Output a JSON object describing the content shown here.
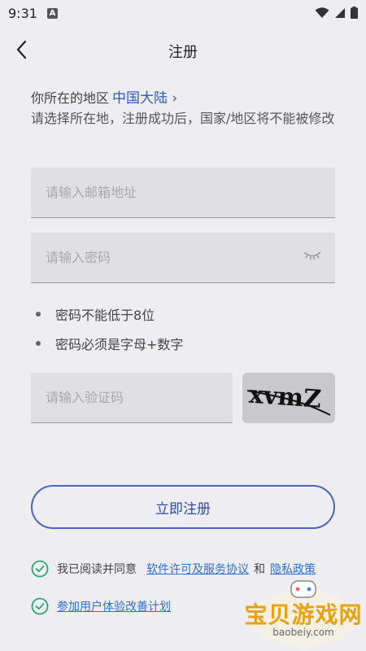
{
  "status": {
    "time": "9:31",
    "notif": "A"
  },
  "header": {
    "title": "注册"
  },
  "region": {
    "label": "你所在的地区",
    "value": "中国大陆 ›",
    "hint": "请选择所在地，注册成功后，国家/地区将不能被修改"
  },
  "form": {
    "email_placeholder": "请输入邮箱地址",
    "password_placeholder": "请输入密码",
    "captcha_placeholder": "请输入验证码",
    "captcha_text": "xvmZ"
  },
  "rules": [
    "密码不能低于8位",
    "密码必须是字母+数字"
  ],
  "submit_label": "立即注册",
  "agreement": {
    "prefix": "我已阅读并同意",
    "license_link": "软件许可及服务协议",
    "and": "和",
    "privacy_link": "隐私政策"
  },
  "improve_link": "参加用户体验改善计划",
  "watermark": {
    "title": "宝贝游戏网",
    "url": "baobeiy.com"
  },
  "colors": {
    "accent": "#2d5bb8",
    "check": "#2aa86a",
    "background": "#ededf2"
  },
  "icons": [
    "back-arrow-icon",
    "eye-closed-icon",
    "check-circle-icon",
    "wifi-icon",
    "signal-icon",
    "battery-icon"
  ]
}
